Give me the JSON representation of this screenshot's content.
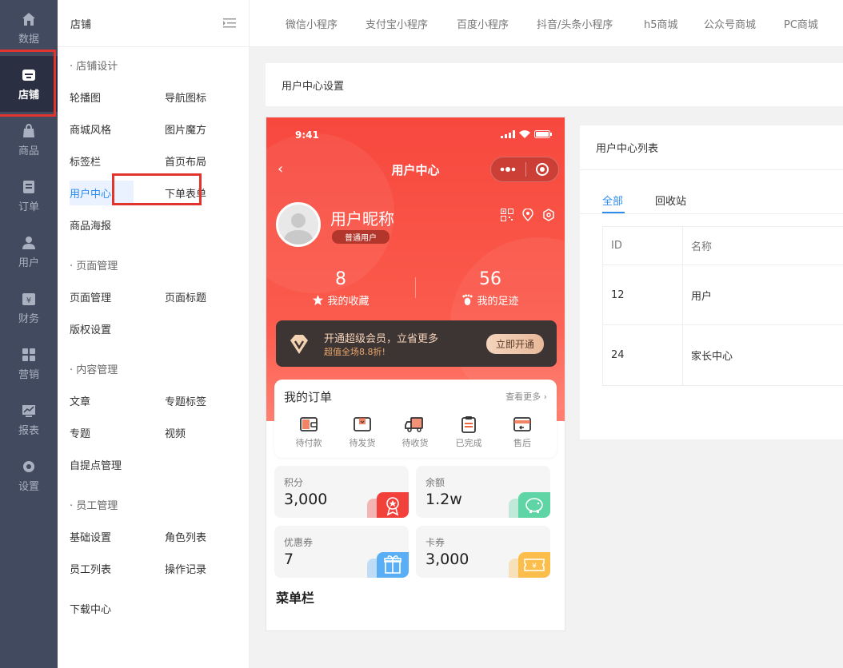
{
  "rail": {
    "items": [
      {
        "label": "数据",
        "icon": "home-icon"
      },
      {
        "label": "店铺",
        "icon": "store-icon"
      },
      {
        "label": "商品",
        "icon": "bag-icon"
      },
      {
        "label": "订单",
        "icon": "order-icon"
      },
      {
        "label": "用户",
        "icon": "user-icon"
      },
      {
        "label": "财务",
        "icon": "finance-icon"
      },
      {
        "label": "营销",
        "icon": "marketing-icon"
      },
      {
        "label": "报表",
        "icon": "report-icon"
      },
      {
        "label": "设置",
        "icon": "gear-icon"
      }
    ],
    "active": "店铺"
  },
  "sub": {
    "title": "店铺",
    "groups": [
      {
        "title": "· 店铺设计",
        "items": [
          "轮播图",
          "导航图标",
          "商城风格",
          "图片魔方",
          "标签栏",
          "首页布局",
          "用户中心",
          "下单表单",
          "商品海报"
        ]
      },
      {
        "title": "· 页面管理",
        "items": [
          "页面管理",
          "页面标题",
          "版权设置"
        ]
      },
      {
        "title": "· 内容管理",
        "items": [
          "文章",
          "专题标签",
          "专题",
          "视频",
          "自提点管理"
        ]
      },
      {
        "title": "· 员工管理",
        "items": [
          "基础设置",
          "角色列表",
          "员工列表",
          "操作记录"
        ]
      }
    ],
    "download": "下载中心",
    "active": "用户中心"
  },
  "topbar": {
    "tabs": [
      "微信小程序",
      "支付宝小程序",
      "百度小程序",
      "抖音/头条小程序",
      "h5商城",
      "公众号商城",
      "PC商城"
    ]
  },
  "settings_title": "用户中心设置",
  "phone": {
    "time": "9:41",
    "title": "用户中心",
    "nickname": "用户昵称",
    "level": "普通用户",
    "stats": [
      {
        "value": "8",
        "label": "我的收藏"
      },
      {
        "value": "56",
        "label": "我的足迹"
      }
    ],
    "vip": {
      "line1": "开通超级会员，立省更多",
      "line2": "超值全场8.8折!",
      "button": "立即开通"
    },
    "orders": {
      "title": "我的订单",
      "more": "查看更多",
      "items": [
        "待付款",
        "待发货",
        "待收货",
        "已完成",
        "售后"
      ]
    },
    "cards": [
      {
        "label": "积分",
        "value": "3,000",
        "color": "#f2403a"
      },
      {
        "label": "余额",
        "value": "1.2w",
        "color": "#5fd5a5"
      },
      {
        "label": "优惠券",
        "value": "7",
        "color": "#5aaef5"
      },
      {
        "label": "卡券",
        "value": "3,000",
        "color": "#fbbe4c"
      }
    ],
    "menu_title": "菜单栏"
  },
  "list": {
    "title": "用户中心列表",
    "tabs": [
      "全部",
      "回收站"
    ],
    "columns": [
      "ID",
      "名称"
    ],
    "rows": [
      {
        "id": "12",
        "name": "用户"
      },
      {
        "id": "24",
        "name": "家长中心"
      }
    ]
  }
}
